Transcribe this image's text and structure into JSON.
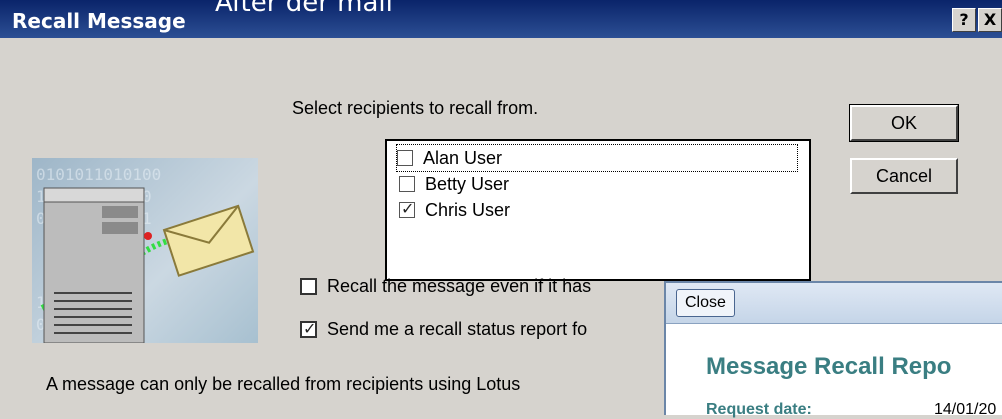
{
  "window": {
    "title": "Recall Message",
    "overlay_caption": "After der mail",
    "help_label": "?",
    "close_label": "X"
  },
  "dialog": {
    "prompt": "Select recipients to recall from.",
    "recipients": [
      {
        "name": "Alan User",
        "checked": false
      },
      {
        "name": "Betty User",
        "checked": false
      },
      {
        "name": "Chris User",
        "checked": true
      }
    ],
    "ok_label": "OK",
    "cancel_label": "Cancel",
    "options": [
      {
        "label": "Recall the message even if it has",
        "checked": false
      },
      {
        "label": "Send me a recall status report fo",
        "checked": true
      }
    ],
    "footer_text": "A message can only be recalled from recipients using Lotus"
  },
  "report": {
    "close_label": "Close",
    "title": "Message Recall Repo",
    "request_date_label": "Request date:",
    "request_date_value": "14/01/20"
  },
  "colors": {
    "titlebar": "#0a246a",
    "dialog_bg": "#d6d3ce",
    "report_heading": "#3a7e82"
  },
  "icons": {
    "illustration": "mail-server-illustration"
  }
}
